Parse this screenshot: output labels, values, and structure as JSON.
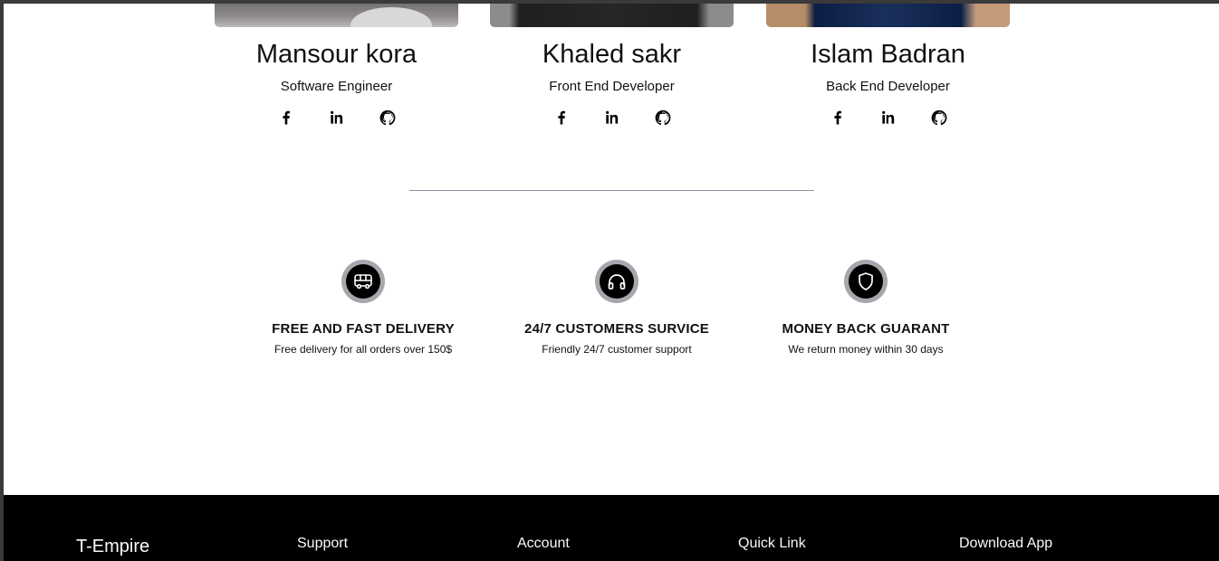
{
  "team": [
    {
      "name": "Mansour kora",
      "role": "Software Engineer"
    },
    {
      "name": "Khaled sakr",
      "role": "Front End Developer"
    },
    {
      "name": "Islam Badran",
      "role": "Back End Developer"
    }
  ],
  "social_icons": [
    "facebook-icon",
    "linkedin-icon",
    "github-icon"
  ],
  "services": [
    {
      "icon": "delivery-van-icon",
      "title": "FREE AND FAST DELIVERY",
      "desc": "Free delivery for all orders over 150$"
    },
    {
      "icon": "headphones-icon",
      "title": "24/7 CUSTOMERS SURVICE",
      "desc": "Friendly 24/7 customer support"
    },
    {
      "icon": "shield-icon",
      "title": "MONEY BACK GUARANT",
      "desc": "We return money within 30 days"
    }
  ],
  "footer": {
    "brand": "T-Empire",
    "columns": [
      "Support",
      "Account",
      "Quick Link",
      "Download App"
    ]
  },
  "colors": {
    "background": "#ffffff",
    "footer_bg": "#000000",
    "badge_ring": "#a6a6ad",
    "divider": "#8a98a6"
  }
}
